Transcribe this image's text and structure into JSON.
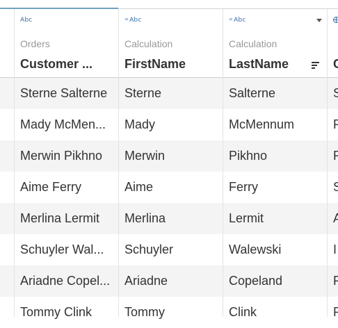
{
  "columns": [
    {
      "type_label": "Abc",
      "source": "Orders",
      "name": "Customer ...",
      "values": [
        "Sterne Salterne",
        "Mady McMen...",
        "Merwin Pikhno",
        "Aime Ferry",
        "Merlina Lermit",
        "Schuyler Wal...",
        "Ariadne Copel...",
        "Tommy Clink"
      ]
    },
    {
      "type_label": "Abc",
      "calc_mark": "=",
      "source": "Calculation",
      "name": "FirstName",
      "values": [
        "Sterne",
        "Mady",
        "Merwin",
        "Aime",
        "Merlina",
        "Schuyler",
        "Ariadne",
        "Tommy"
      ]
    },
    {
      "type_label": "Abc",
      "calc_mark": "=",
      "source": "Calculation",
      "name": "LastName",
      "values": [
        "Salterne",
        "McMennum",
        "Pikhno",
        "Ferry",
        "Lermit",
        "Walewski",
        "Copeland",
        "Clink"
      ]
    },
    {
      "source": "C",
      "name": "C",
      "values": [
        "S",
        "P",
        "R",
        "S",
        "A",
        "I",
        "P",
        "P"
      ]
    }
  ],
  "icons": {
    "type_icon": "string-type-icon",
    "calc_icon": "calculated-string-icon",
    "dropdown": "chevron-down-icon",
    "sort": "sort-icon",
    "geo": "globe-icon"
  },
  "colors": {
    "accent": "#6fa1c1",
    "type_icon": "#3a6ea5",
    "alt_row": "#f4f4f4"
  }
}
